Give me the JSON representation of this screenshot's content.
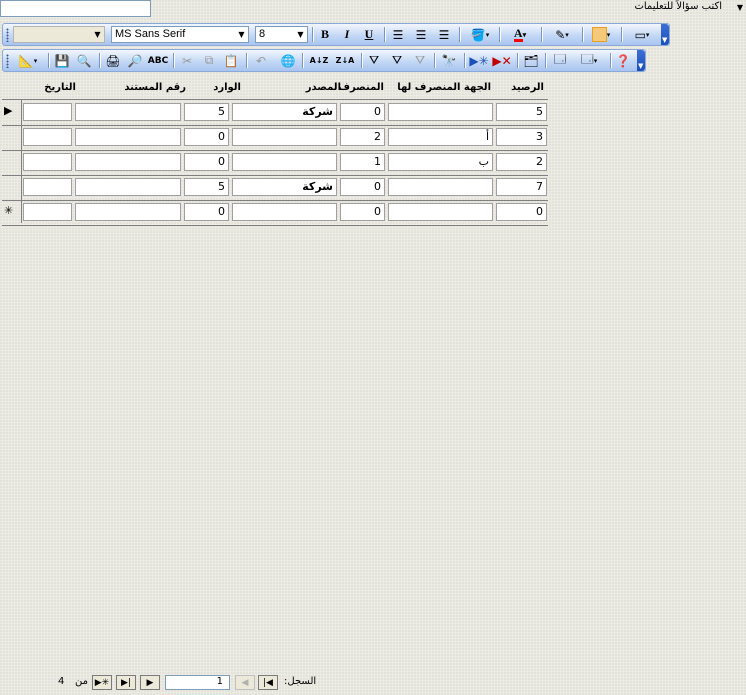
{
  "ask_question": {
    "placeholder": "اكتب سؤالاً للتعليمات"
  },
  "format_toolbar": {
    "object_combo_value": "",
    "font_name": "MS Sans Serif",
    "font_size": "8",
    "bold_label": "B",
    "italic_label": "I",
    "underline_label": "U",
    "font_color": "#ff0000",
    "border_color": "#e8a020"
  },
  "standard_toolbar": {
    "sort_asc_label": "A↓Z",
    "sort_desc_label": "Z↓A"
  },
  "datasheet": {
    "columns": [
      "الرصيد",
      "الجهة المنصرف لها",
      "المنصرف",
      "المصدر",
      "الوارد",
      "رقم المستند",
      "التاريخ"
    ],
    "rows": [
      {
        "selector": "▶",
        "balance": "5",
        "recipient": "",
        "issued": "0",
        "source": "شركة",
        "received": "5",
        "doc_no": "",
        "date": ""
      },
      {
        "selector": "",
        "balance": "3",
        "recipient": "أ",
        "issued": "2",
        "source": "",
        "received": "0",
        "doc_no": "",
        "date": ""
      },
      {
        "selector": "",
        "balance": "2",
        "recipient": "ب",
        "issued": "1",
        "source": "",
        "received": "0",
        "doc_no": "",
        "date": ""
      },
      {
        "selector": "",
        "balance": "7",
        "recipient": "",
        "issued": "0",
        "source": "شركة",
        "received": "5",
        "doc_no": "",
        "date": ""
      },
      {
        "selector": "✳",
        "balance": "0",
        "recipient": "",
        "issued": "0",
        "source": "",
        "received": "0",
        "doc_no": "",
        "date": ""
      }
    ]
  },
  "navigation": {
    "record_label": "السجل:",
    "current_record": "1",
    "of_label": "من",
    "total_records": "4"
  }
}
